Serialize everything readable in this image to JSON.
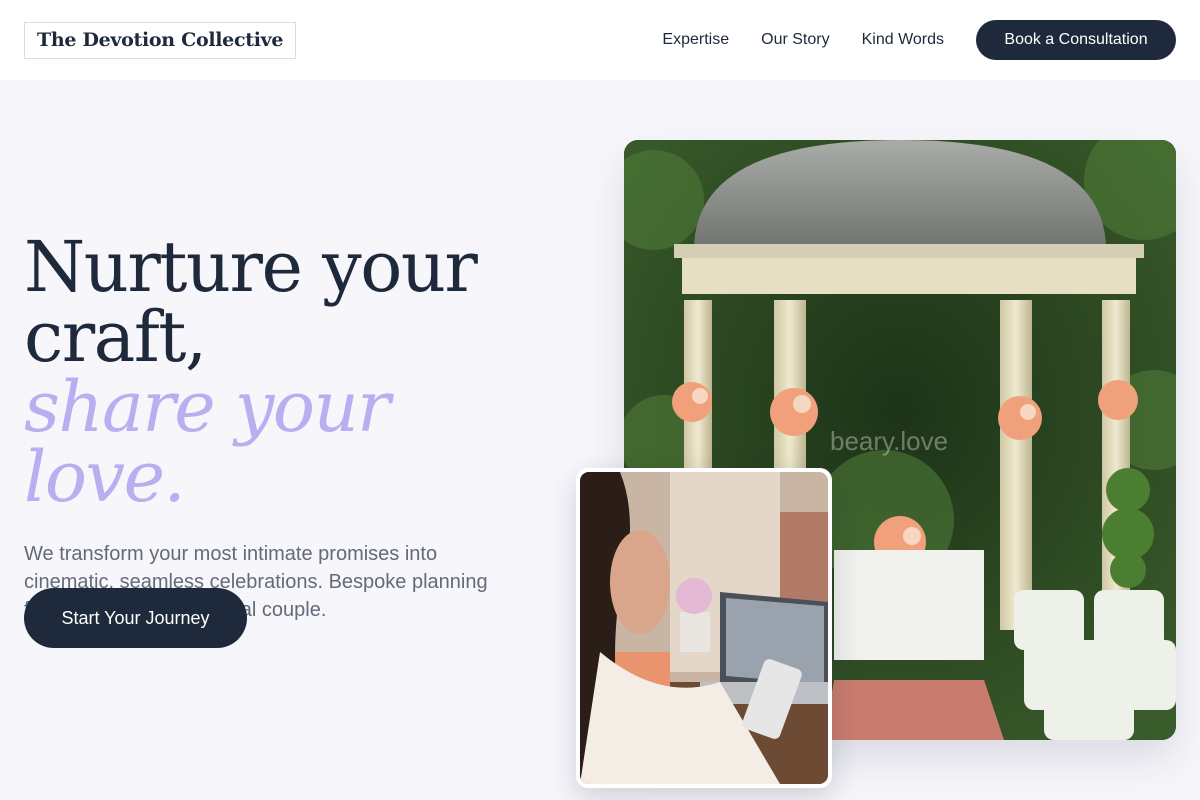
{
  "brand": {
    "name": "The Devotion Collective"
  },
  "nav": {
    "links": [
      "Expertise",
      "Our Story",
      "Kind Words"
    ],
    "cta_label": "Book a Consultation"
  },
  "hero": {
    "headline_line1": "Nurture your",
    "headline_line2": "craft,",
    "headline_accent": "share your love.",
    "subtitle": "We transform your most intimate promises into cinematic, seamless celebrations. Bespoke planning for the modern, intentional couple.",
    "button_label": "Start Your Journey"
  },
  "images": {
    "main_watermark": "beary.love",
    "main_icon": "gazebo-ceremony-photo",
    "inset_icon": "planner-laptop-photo"
  },
  "colors": {
    "primary": "#1e293b",
    "accent": "#b9aef0",
    "background": "#f6f6fb",
    "text_muted": "#636b78"
  }
}
